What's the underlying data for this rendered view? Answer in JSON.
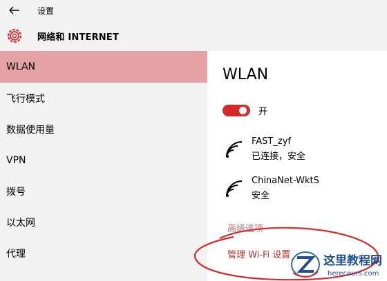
{
  "titlebar": {
    "title": "设置"
  },
  "header": {
    "title": "网络和 INTERNET"
  },
  "sidebar": {
    "items": [
      {
        "label": "WLAN"
      },
      {
        "label": "飞行模式"
      },
      {
        "label": "数据使用量"
      },
      {
        "label": "VPN"
      },
      {
        "label": "拨号"
      },
      {
        "label": "以太网"
      },
      {
        "label": "代理"
      }
    ]
  },
  "main": {
    "heading": "WLAN",
    "toggle_label": "开",
    "networks": [
      {
        "ssid": "FAST_zyf",
        "status": "已连接，安全"
      },
      {
        "ssid": "ChinaNet-WktS",
        "status": "安全"
      }
    ],
    "advanced_link": "高级选项",
    "manage_link": "管理 Wi-Fi 设置"
  },
  "watermark": {
    "brand": "这里教程网",
    "url": "herecours.com"
  },
  "colors": {
    "accent": "#d42a2a",
    "selected": "#e4a2a4",
    "link": "#b83030",
    "panel": "#f2f2f2"
  },
  "icons": {
    "back": "arrow-left-icon",
    "settings": "gear-icon",
    "network": "wifi-icon"
  }
}
